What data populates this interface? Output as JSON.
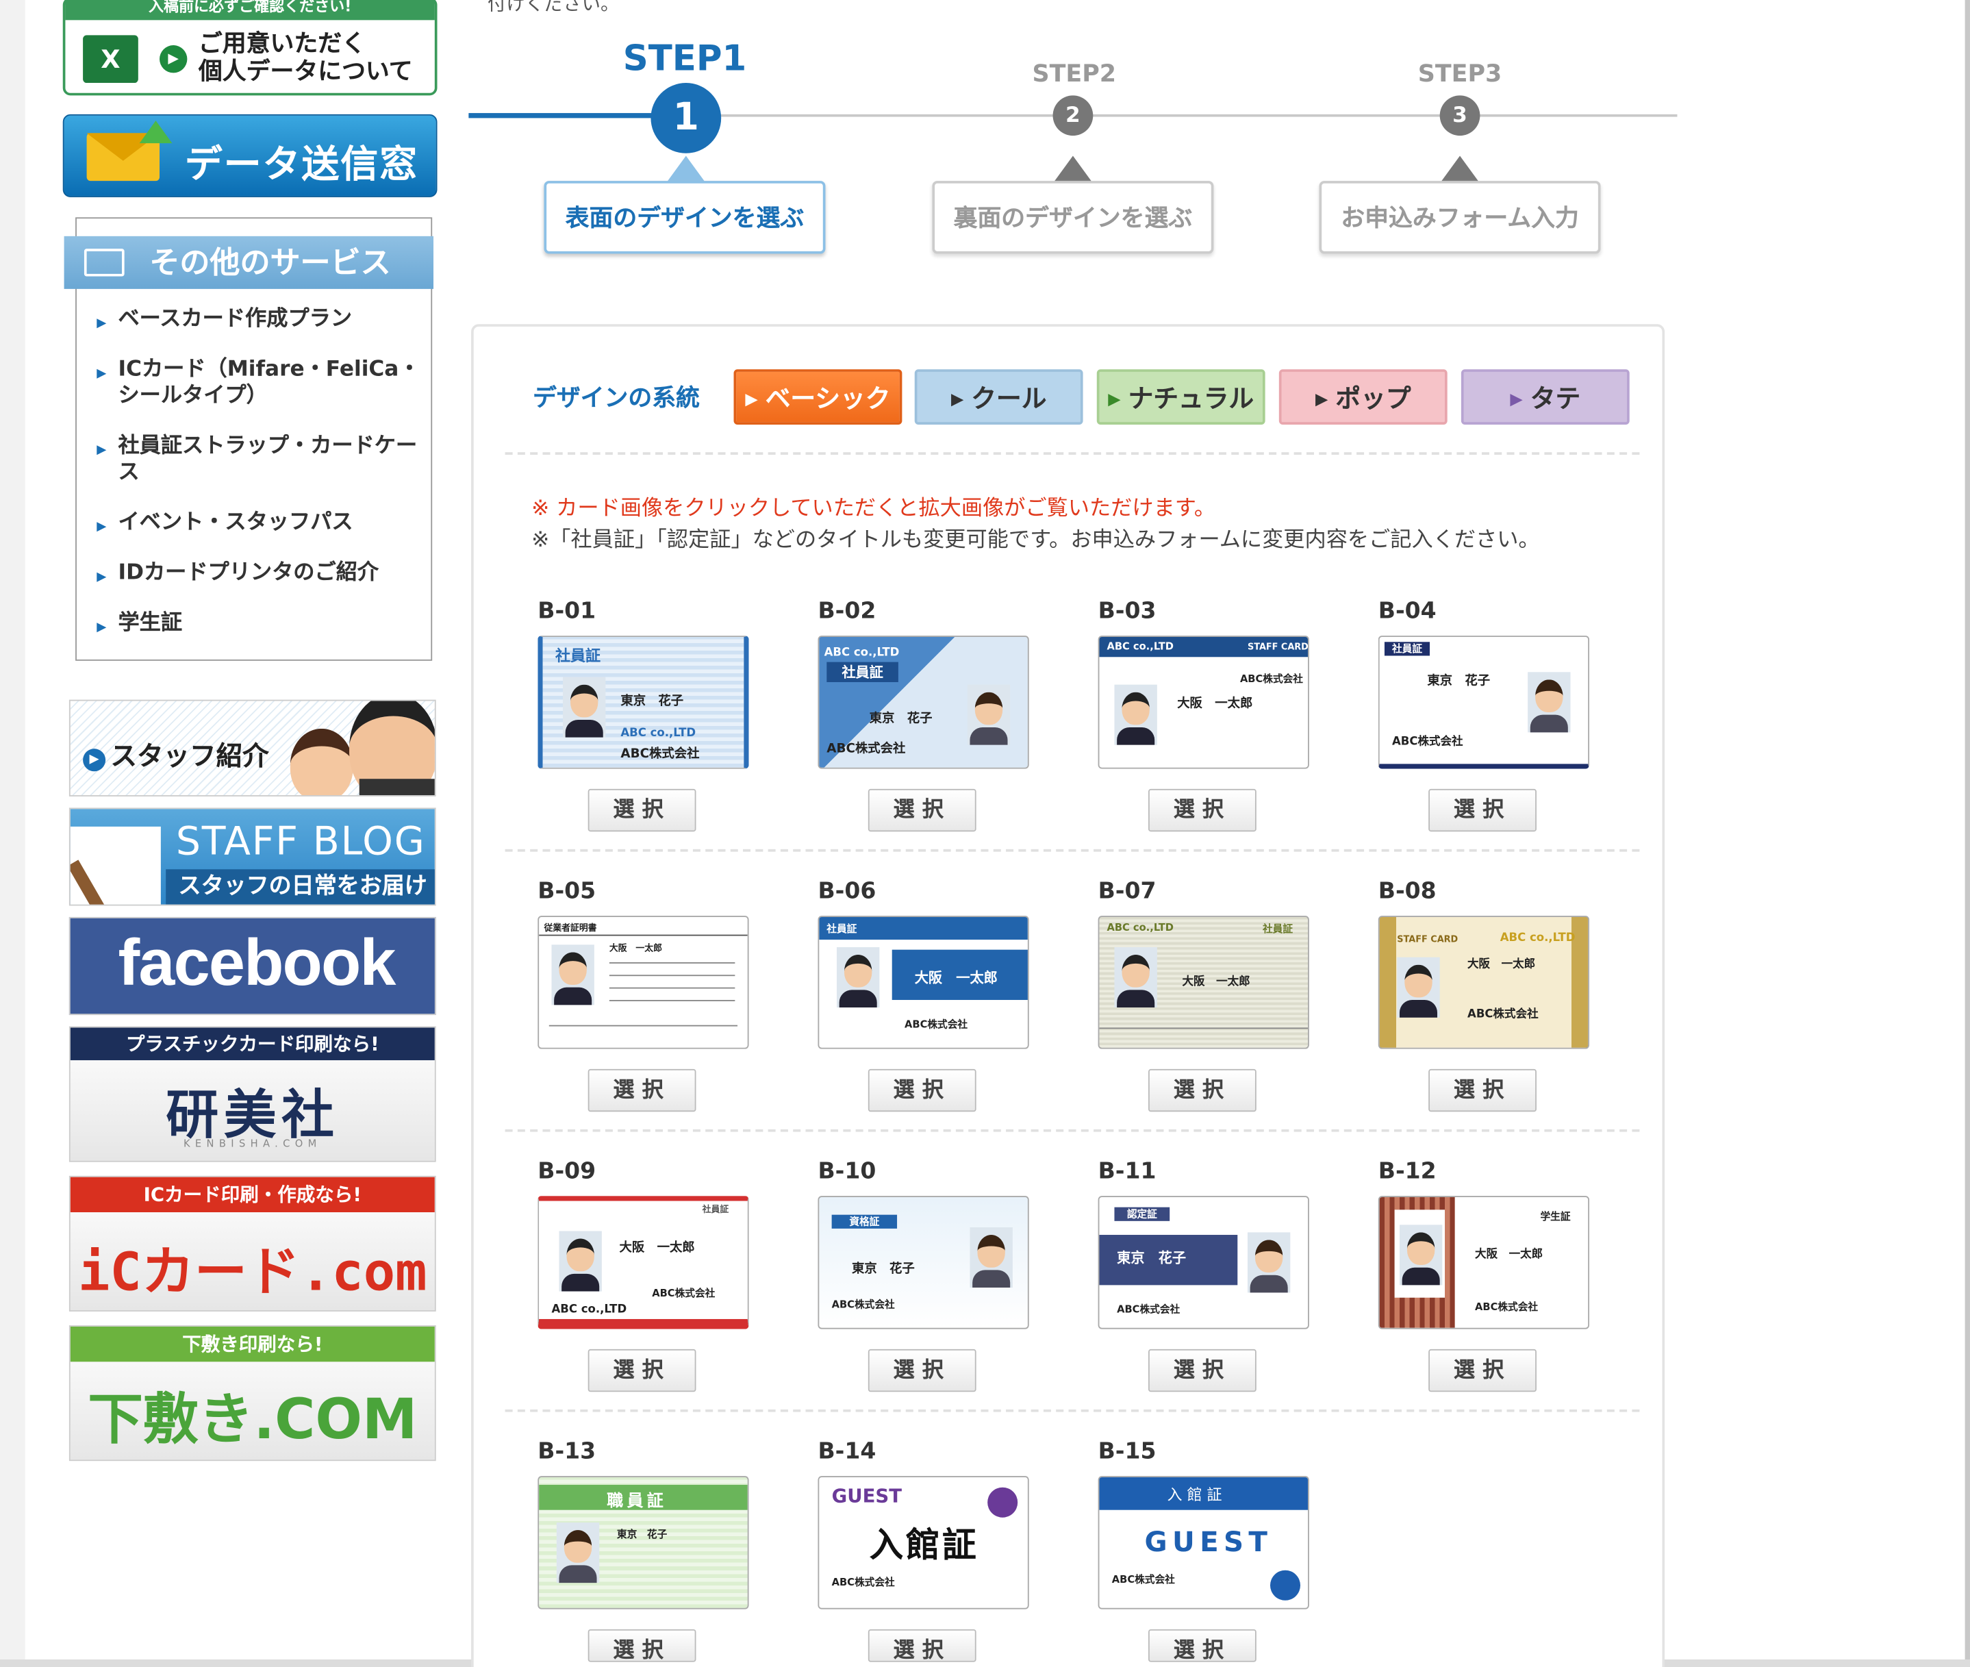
{
  "sidebar": {
    "pdata_top": "入稿前に必ずご確認ください!",
    "pdata_line1": "ご用意いただく",
    "pdata_line2": "個人データについて",
    "send_label": "データ送信窓口",
    "other_services_title": "その他のサービス",
    "services": [
      "ベースカード作成プラン",
      "ICカード（Mifare・FeliCa・シールタイプ）",
      "社員証ストラップ・カードケース",
      "イベント・スタッフパス",
      "IDカードプリンタのご紹介",
      "学生証"
    ],
    "staff_intro": "スタッフ紹介",
    "blog_title": "STAFF BLOG",
    "blog_sub": "スタッフの日常をお届け♪",
    "facebook": "facebook",
    "kenbi_top": "プラスチックカード印刷なら!",
    "kenbi_logo": "研美社",
    "kenbi_sub": "KENBISHA.COM",
    "ic_top": "ICカード印刷・作成なら!",
    "ic_logo": "iCカード.com",
    "shiki_top": "下敷き印刷なら!",
    "shiki_logo": "下敷き.COM"
  },
  "top_cut_text": "付けください。",
  "steps": [
    {
      "label": "STEP1",
      "num": "1",
      "box": "表面のデザインを選ぶ",
      "active": true
    },
    {
      "label": "STEP2",
      "num": "2",
      "box": "裏面のデザインを選ぶ",
      "active": false
    },
    {
      "label": "STEP3",
      "num": "3",
      "box": "お申込みフォーム入力",
      "active": false
    }
  ],
  "design_label": "デザインの系統",
  "categories": [
    {
      "label": "ベーシック",
      "color": "#f06a1a"
    },
    {
      "label": "クール",
      "color": "#b7d5ec"
    },
    {
      "label": "ナチュラル",
      "color": "#c6e3b4"
    },
    {
      "label": "ポップ",
      "color": "#f6c3c8"
    },
    {
      "label": "タテ",
      "color": "#cfbfe0"
    }
  ],
  "notes": {
    "red": "※ カード画像をクリックしていただくと拡大画像がご覧いただけます。",
    "gray": "※「社員証」「認定証」などのタイトルも変更可能です。お申込みフォームに変更内容をご記入ください。"
  },
  "select_label": "選択",
  "designs": [
    {
      "id": "B-01"
    },
    {
      "id": "B-02"
    },
    {
      "id": "B-03"
    },
    {
      "id": "B-04"
    },
    {
      "id": "B-05"
    },
    {
      "id": "B-06"
    },
    {
      "id": "B-07"
    },
    {
      "id": "B-08"
    },
    {
      "id": "B-09"
    },
    {
      "id": "B-10"
    },
    {
      "id": "B-11"
    },
    {
      "id": "B-12"
    },
    {
      "id": "B-13"
    },
    {
      "id": "B-14"
    },
    {
      "id": "B-15"
    }
  ],
  "card_text": {
    "shainsho": "社員証",
    "shokuinsho": "職員証",
    "nyukansho": "入館証",
    "nyukansho_spaced": "入 館 証",
    "guest": "GUEST",
    "abc": "ABC株式会社",
    "abc_logo": "ABC co.,LTD",
    "staff_card": "STAFF CARD",
    "name_f": "東京　花子",
    "name_m": "大阪　一太郎",
    "shikakusho": "資格証",
    "ninteisho": "認定証",
    "gakuseisho": "学生証",
    "jugyoin": "従業者証明書"
  }
}
